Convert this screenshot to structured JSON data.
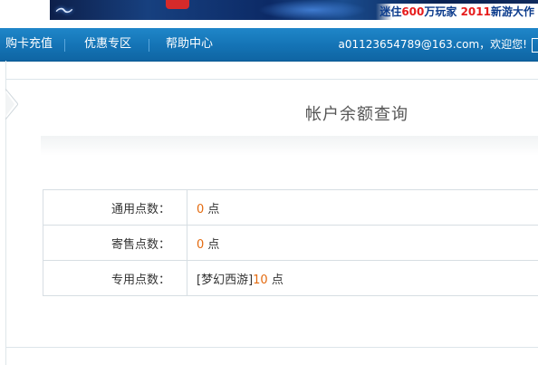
{
  "banner": {
    "promo_prefix": "迷住",
    "promo_count": "600",
    "promo_mid": "万玩家 ",
    "promo_year": "2011",
    "promo_suffix": "新游大作"
  },
  "nav": {
    "items": [
      {
        "label": "购卡充值"
      },
      {
        "label": "优惠专区"
      },
      {
        "label": "帮助中心"
      }
    ],
    "user_greeting": "a01123654789@163.com，欢迎您!"
  },
  "page": {
    "title": "帐户余额查询"
  },
  "balances": {
    "rows": [
      {
        "label": "通用点数：",
        "prefix": "",
        "value": "0",
        "unit": "点"
      },
      {
        "label": "寄售点数：",
        "prefix": "",
        "value": "0",
        "unit": "点"
      },
      {
        "label": "专用点数：",
        "prefix": "[梦幻西游]",
        "value": "10",
        "unit": "点"
      }
    ]
  },
  "colors": {
    "nav_bg": "#1473b5",
    "value_accent": "#e46b10",
    "promo_red": "#e61c1c",
    "promo_blue": "#0b3b8c"
  }
}
